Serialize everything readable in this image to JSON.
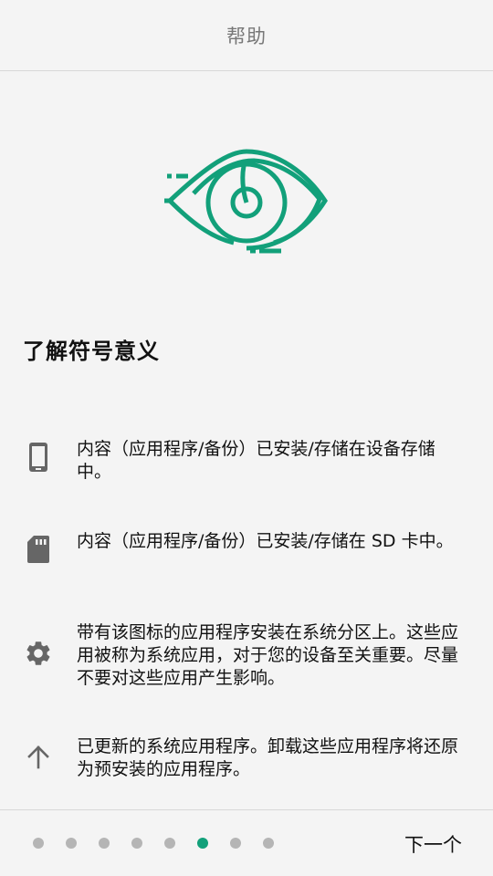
{
  "header": {
    "title": "帮助"
  },
  "hero": {
    "icon": "eye-icon",
    "color": "#12a07a"
  },
  "section": {
    "heading": "了解符号意义"
  },
  "legend": [
    {
      "icon": "phone-icon",
      "text": "内容（应用程序/备份）已安装/存储在设备存储中。"
    },
    {
      "icon": "sd-card-icon",
      "text": "内容（应用程序/备份）已安装/存储在 SD 卡中。"
    },
    {
      "icon": "gear-icon",
      "text": "带有该图标的应用程序安装在系统分区上。这些应用被称为系统应用，对于您的设备至关重要。尽量不要对这些应用产生影响。"
    },
    {
      "icon": "arrow-up-icon",
      "text": "已更新的系统应用程序。卸载这些应用程序将还原为预安装的应用程序。"
    }
  ],
  "footer": {
    "page_count": 8,
    "current_page": 6,
    "next_label": "下一个",
    "dot_color": "#b5b5b5",
    "active_dot_color": "#12a07a"
  }
}
